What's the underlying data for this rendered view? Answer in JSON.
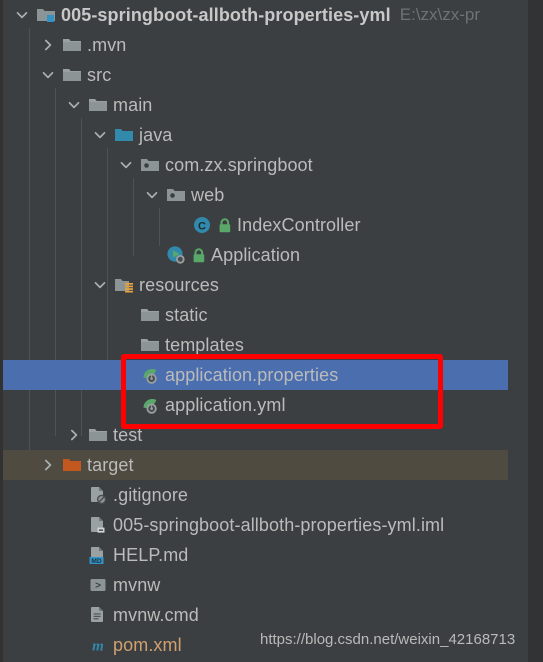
{
  "window": {
    "theme": "darcula",
    "panel": "project-tree",
    "background": "#3c3f41",
    "selection_color": "#4b6eaf",
    "excluded_color": "#4f4b41",
    "annotation_color": "#fe0000"
  },
  "scrollbar": {
    "orientation": "vertical",
    "thumb_color": "#5b5e60"
  },
  "watermark": {
    "text": "https://blog.csdn.net/weixin_42168713"
  },
  "tree": {
    "rows": [
      {
        "id": "root",
        "label": "005-springboot-allboth-properties-yml",
        "path_hint": "E:\\zx\\zx-pr",
        "icon": "module-folder-icon",
        "chevron": "expanded",
        "depth": 0,
        "bold": true,
        "state": "normal"
      },
      {
        "id": "mvn",
        "label": ".mvn",
        "icon": "folder-icon",
        "chevron": "collapsed",
        "depth": 1,
        "bold": false,
        "state": "normal"
      },
      {
        "id": "src",
        "label": "src",
        "icon": "folder-icon",
        "chevron": "expanded",
        "depth": 1,
        "bold": false,
        "state": "normal"
      },
      {
        "id": "main",
        "label": "main",
        "icon": "folder-icon",
        "chevron": "expanded",
        "depth": 2,
        "bold": false,
        "state": "normal"
      },
      {
        "id": "java",
        "label": "java",
        "icon": "source-root-folder-icon",
        "chevron": "expanded",
        "depth": 3,
        "bold": false,
        "state": "normal"
      },
      {
        "id": "package",
        "label": "com.zx.springboot",
        "icon": "package-icon",
        "chevron": "expanded",
        "depth": 4,
        "bold": false,
        "state": "normal"
      },
      {
        "id": "web",
        "label": "web",
        "icon": "package-icon",
        "chevron": "expanded",
        "depth": 5,
        "bold": false,
        "state": "normal"
      },
      {
        "id": "indexcontroller",
        "label": "IndexController",
        "icon": "java-class-icon",
        "badge": "green-lock-icon",
        "chevron": "none",
        "depth": 6,
        "bold": false,
        "state": "normal"
      },
      {
        "id": "application",
        "label": "Application",
        "icon": "spring-boot-run-icon",
        "badge": "green-lock-icon",
        "chevron": "none",
        "depth": 5,
        "bold": false,
        "state": "normal"
      },
      {
        "id": "resources",
        "label": "resources",
        "icon": "resources-root-folder-icon",
        "chevron": "expanded",
        "depth": 3,
        "bold": false,
        "state": "normal"
      },
      {
        "id": "static",
        "label": "static",
        "icon": "folder-icon",
        "chevron": "none",
        "depth": 4,
        "bold": false,
        "state": "normal"
      },
      {
        "id": "templates",
        "label": "templates",
        "icon": "folder-icon",
        "chevron": "none",
        "depth": 4,
        "bold": false,
        "state": "normal"
      },
      {
        "id": "application-properties",
        "label": "application.properties",
        "icon": "spring-config-icon",
        "chevron": "none",
        "depth": 4,
        "bold": false,
        "state": "selected"
      },
      {
        "id": "application-yml",
        "label": "application.yml",
        "icon": "spring-config-icon",
        "chevron": "none",
        "depth": 4,
        "bold": false,
        "state": "normal"
      },
      {
        "id": "test",
        "label": "test",
        "icon": "folder-icon",
        "chevron": "collapsed",
        "depth": 2,
        "bold": false,
        "state": "normal"
      },
      {
        "id": "target",
        "label": "target",
        "icon": "excluded-folder-icon",
        "chevron": "collapsed",
        "depth": 1,
        "bold": false,
        "state": "excluded"
      },
      {
        "id": "gitignore",
        "label": ".gitignore",
        "icon": "gitignore-file-icon",
        "chevron": "none",
        "depth": 2,
        "bold": false,
        "state": "normal"
      },
      {
        "id": "iml",
        "label": "005-springboot-allboth-properties-yml.iml",
        "icon": "iml-file-icon",
        "chevron": "none",
        "depth": 2,
        "bold": false,
        "state": "normal"
      },
      {
        "id": "help",
        "label": "HELP.md",
        "icon": "markdown-file-icon",
        "chevron": "none",
        "depth": 2,
        "bold": false,
        "state": "normal"
      },
      {
        "id": "mvnw",
        "label": "mvnw",
        "icon": "shell-script-icon",
        "chevron": "none",
        "depth": 2,
        "bold": false,
        "state": "normal"
      },
      {
        "id": "mvnw-cmd",
        "label": "mvnw.cmd",
        "icon": "cmd-file-icon",
        "chevron": "none",
        "depth": 2,
        "bold": false,
        "state": "normal"
      },
      {
        "id": "pom",
        "label": "pom.xml",
        "icon": "maven-pom-icon",
        "chevron": "none",
        "depth": 2,
        "bold": false,
        "state": "maven"
      }
    ]
  },
  "annotation": {
    "shape": "rectangle",
    "color": "#fe0000",
    "targets": [
      "application.properties",
      "application.yml"
    ]
  }
}
